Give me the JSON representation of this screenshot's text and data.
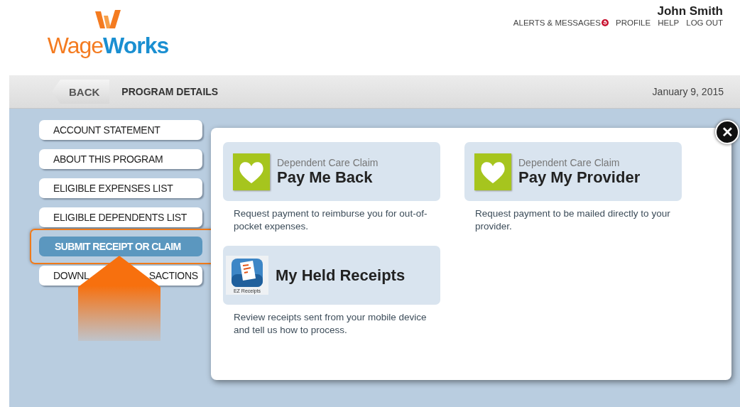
{
  "logo": {
    "text": "Wage**Works**"
  },
  "user": {
    "name": "John Smith"
  },
  "top_links": [
    {
      "label": "ALERTS & MESSAGES",
      "kind": "alert"
    },
    {
      "label": "PROFILE",
      "kind": "link"
    },
    {
      "label": "HELP",
      "kind": "link"
    },
    {
      "label": "LOG OUT",
      "kind": "link"
    }
  ],
  "toolbar": {
    "back": "BACK",
    "title": "PROGRAM DETAILS",
    "date": "January 9, 2015"
  },
  "sidebar": {
    "items": [
      {
        "label_parts": [
          "ACCOUNT STATEMENT"
        ],
        "selected": false
      },
      {
        "label_parts": [
          "ABOUT THIS PROGRAM"
        ],
        "selected": false
      },
      {
        "label_parts": [
          "ELIGIBLE EXPENSES LIST"
        ],
        "selected": false
      },
      {
        "label_parts": [
          "ELIGIBLE DEPENDENTS LIST"
        ],
        "selected": false
      },
      {
        "label_parts": [
          "SUBMIT RECEIPT OR CLAIM"
        ],
        "selected": true
      },
      {
        "label_parts": [
          "DOWNL",
          "SACTIONS"
        ],
        "selected": false
      }
    ]
  },
  "modal": {
    "close": "✕",
    "tiles": [
      {
        "kind": "heart",
        "subtitle": "Dependent Care Claim",
        "title": "Pay Me Back",
        "description": "Request payment to reimburse you for out-of-pocket expenses."
      },
      {
        "kind": "heart",
        "subtitle": "Dependent Care Claim",
        "title": "Pay My Provider",
        "description": "Request payment to be mailed directly to your provider."
      },
      {
        "kind": "receipt",
        "icon_caption": "EZ Receipts",
        "title": "My Held Receipts",
        "description": "Review receipts sent from your mobile device and tell us how to process."
      }
    ]
  }
}
